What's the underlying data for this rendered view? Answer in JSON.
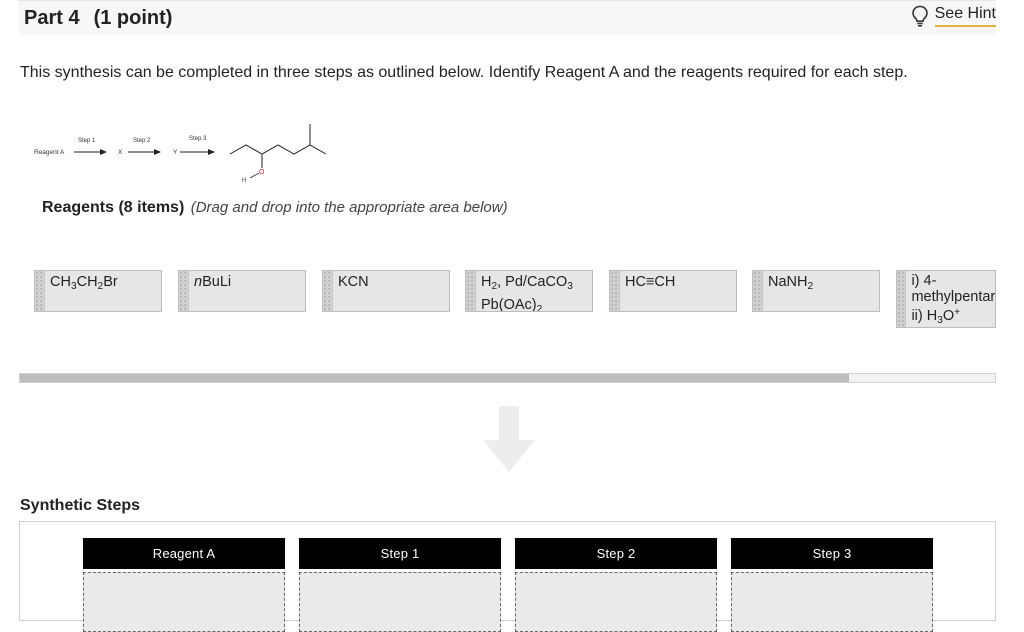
{
  "header": {
    "part": "Part 4",
    "points": "(1 point)",
    "hint_label": "See Hint",
    "hint_icon": "lightbulb-icon"
  },
  "prompt": "This synthesis can be completed in three steps as outlined below. Identify Reagent A and the reagents required for each step.",
  "scheme": {
    "start": "Reagent A",
    "step1": "Step 1",
    "step2": "Step 2",
    "step3": "Step 3",
    "int1": "X",
    "int2": "Y",
    "atom_o": "O",
    "atom_h": "H"
  },
  "reagents": {
    "title": "Reagents (8 items)",
    "instruction": "(Drag and drop into the appropriate area below)",
    "items": [
      {
        "pre": "CH",
        "s1": "3",
        "mid": "CH",
        "s2": "2",
        "post": "Br"
      },
      {
        "italic": "n",
        "text": "BuLi"
      },
      {
        "text": "KCN"
      },
      {
        "line1_a": "H",
        "line1_s": "2",
        "line1_b": ", Pd/CaCO",
        "line1_s2": "3",
        "line2_a": "Pb(OAc)",
        "line2_s": "2"
      },
      {
        "text": "HC≡CH"
      },
      {
        "pre": "NaNH",
        "s1": "2"
      },
      {
        "line1": "i) 4-",
        "line2": "methylpentar",
        "line3_a": "ii) H",
        "line3_s": "3",
        "line3_b": "O",
        "line3_sup": "+"
      }
    ]
  },
  "progress": {
    "fraction": 0.85
  },
  "steps": {
    "title": "Synthetic Steps",
    "columns": [
      "Reagent A",
      "Step 1",
      "Step 2",
      "Step 3"
    ]
  },
  "colors": {
    "accent": "#e0b13c",
    "header_bg": "#f7f7f7",
    "tile_bg": "#e6e6e6",
    "step_header": "#000000"
  }
}
